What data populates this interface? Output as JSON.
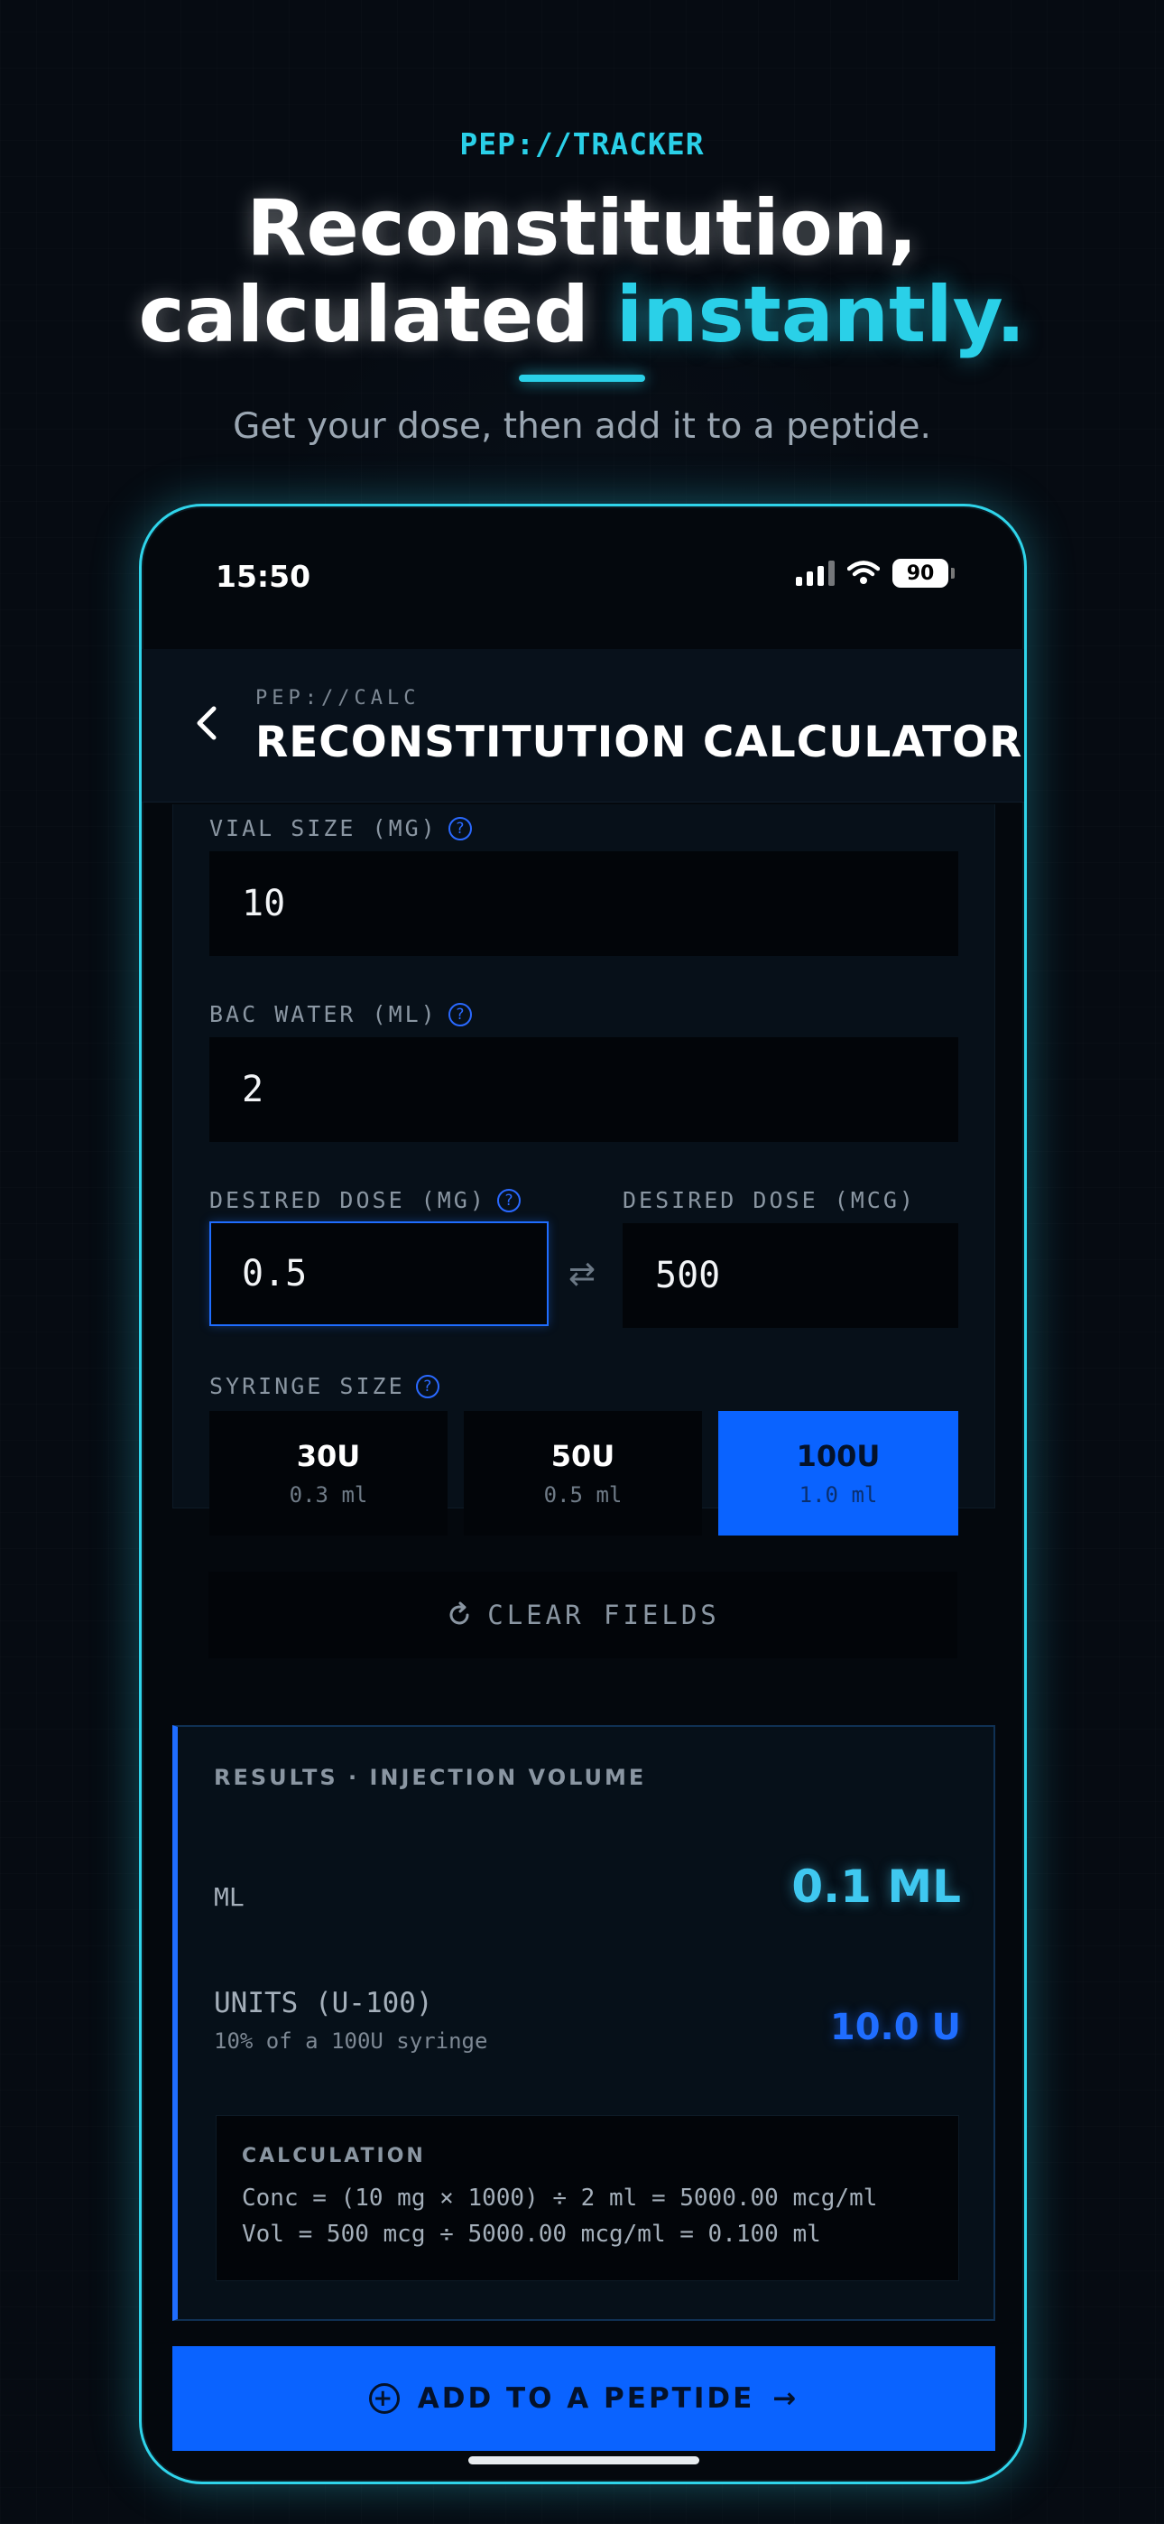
{
  "hero": {
    "kicker": "PEP://TRACKER",
    "title_line1": "Reconstitution,",
    "title_line2_plain": "calculated ",
    "title_line2_accent": "instantly.",
    "subtitle": "Get your dose, then add it to a peptide."
  },
  "status_bar": {
    "time": "15:50",
    "battery": "90"
  },
  "nav": {
    "back_icon": "chevron-left",
    "kicker": "PEP://CALC",
    "title": "RECONSTITUTION CALCULATOR"
  },
  "form": {
    "vial_size": {
      "label": "VIAL SIZE (MG)",
      "value": "10"
    },
    "bac_water": {
      "label": "BAC WATER (ML)",
      "value": "2"
    },
    "dose_mg": {
      "label": "DESIRED DOSE (MG)",
      "value": "0.5"
    },
    "dose_mcg": {
      "label": "DESIRED DOSE (MCG)",
      "value": "500"
    },
    "swap_icon": "⇄",
    "help_icon": "?",
    "syringe": {
      "label": "SYRINGE SIZE",
      "options": [
        {
          "size": "30U",
          "volume": "0.3 ml",
          "selected": false
        },
        {
          "size": "50U",
          "volume": "0.5 ml",
          "selected": false
        },
        {
          "size": "100U",
          "volume": "1.0 ml",
          "selected": true
        }
      ]
    },
    "clear_label": "CLEAR FIELDS"
  },
  "results": {
    "kicker": "RESULTS · INJECTION VOLUME",
    "ml_label": "ML",
    "ml_value": "0.1 ML",
    "units_label": "UNITS (U-100)",
    "units_sub": "10% of a 100U syringe",
    "units_value": "10.0 U",
    "calc_title": "CALCULATION",
    "calc_line1": "Conc = (10 mg × 1000) ÷ 2 ml = 5000.00 mcg/ml",
    "calc_line2": "Vol = 500 mcg ÷ 5000.00 mcg/ml = 0.100 ml"
  },
  "cta": {
    "label": "ADD TO A PEPTIDE",
    "arrow": "→",
    "plus": "+"
  },
  "colors": {
    "accent_cyan": "#2ad0e8",
    "accent_blue": "#0a63ff"
  }
}
